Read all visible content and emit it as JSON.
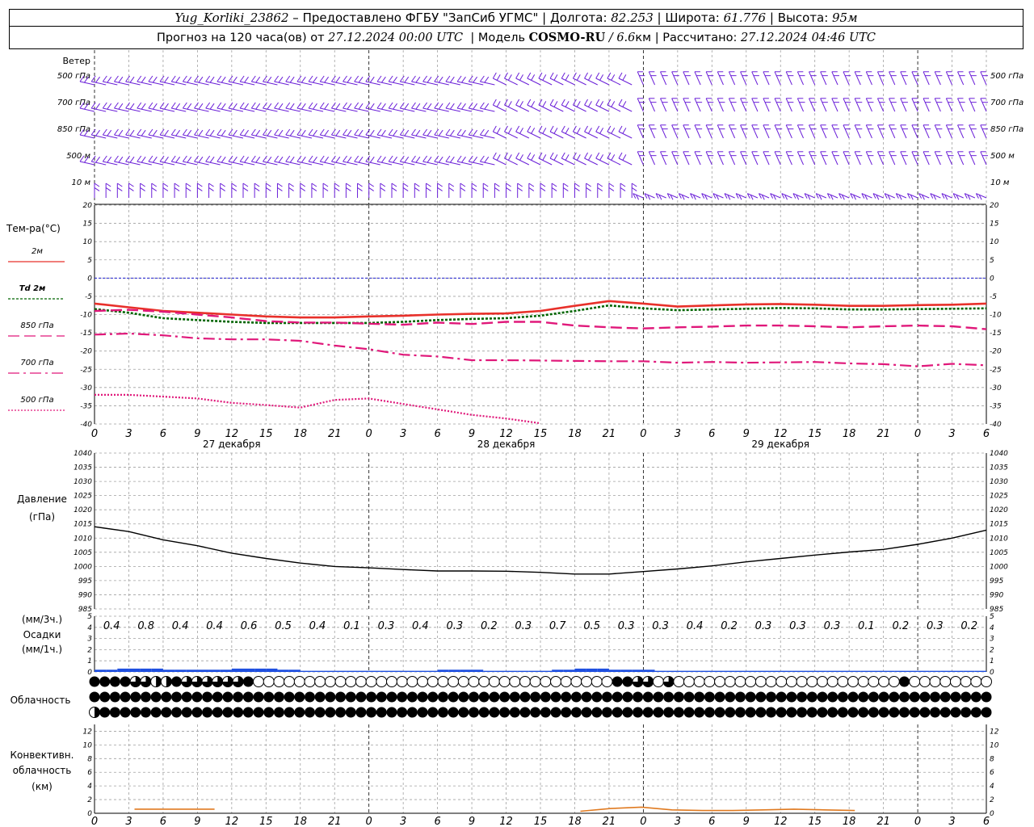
{
  "header": {
    "station": "Yug_Korliki_23862",
    "sep1": " – ",
    "provider": "Предоставлено ФГБУ \"ЗапСиб УГМС\"",
    "lon_label": "Долгота: ",
    "lon": "82.253",
    "lat_label": "Широта: ",
    "lat": "61.776",
    "alt_label": "Высота: ",
    "alt": "95м",
    "forecast_label": "Прогноз на 120 часа(ов) от ",
    "forecast_start": "27.12.2024 00:00 UTC",
    "model_label": "Модель ",
    "model": "COSMO-RU",
    "model_res": " / 6.6",
    "model_res_unit": "км",
    "calc_label": "Рассчитано: ",
    "calc_time": "27.12.2024 04:46 UTC"
  },
  "labels": {
    "wind_title": "Ветер",
    "wind_levels": [
      "500 гПа",
      "700 гПа",
      "850 гПа",
      "500 м",
      "10 м"
    ],
    "temp_title": "Тем-ра(°C)",
    "temp_legend": [
      "2м",
      "Td 2м",
      "850 гПа",
      "700 гПа",
      "500 гПа"
    ],
    "pressure_title": "Давление",
    "pressure_unit": "(гПа)",
    "precip_top": "(мм/3ч.)",
    "precip_title": "Осадки",
    "precip_unit": "(мм/1ч.)",
    "cloud_title": "Облачность",
    "conv_title_1": "Конвективн.",
    "conv_title_2": "облачность",
    "conv_unit": "(км)",
    "days": [
      "27 декабря",
      "28 декабря",
      "29 декабря"
    ]
  },
  "colors": {
    "t2m": "#e8302a",
    "td2m": "#006400",
    "upper": "#e0187a",
    "zero": "#2020d0",
    "wind": "#6a1fd8",
    "pressure": "#000000",
    "precip": "#1e4fe0",
    "conv": "#e07a20"
  },
  "chart_data": [
    {
      "type": "line",
      "name": "temperature",
      "x_hours": [
        0,
        3,
        6,
        9,
        12,
        15,
        18,
        21,
        24,
        27,
        30,
        33,
        36,
        39,
        42,
        45,
        48,
        51,
        54,
        57,
        60,
        63,
        66,
        69,
        72,
        75,
        78
      ],
      "x_tick_labels": [
        "0",
        "3",
        "6",
        "9",
        "12",
        "15",
        "18",
        "21",
        "0",
        "3",
        "6",
        "9",
        "12",
        "15",
        "18",
        "21",
        "0",
        "3",
        "6",
        "9",
        "12",
        "15",
        "18",
        "21",
        "0",
        "3",
        "6"
      ],
      "ylim": [
        -40,
        20
      ],
      "yticks": [
        20,
        15,
        10,
        5,
        0,
        -5,
        -10,
        -15,
        -20,
        -25,
        -30,
        -35,
        -40
      ],
      "series": [
        {
          "name": "2м",
          "style": "solid",
          "values": [
            -7,
            -8,
            -9,
            -9.5,
            -10,
            -10.5,
            -10.8,
            -10.8,
            -10.5,
            -10.3,
            -10,
            -9.8,
            -9.7,
            -9,
            -7.6,
            -6.3,
            -7,
            -7.8,
            -7.5,
            -7.2,
            -7.1,
            -7.3,
            -7.6,
            -7.6,
            -7.4,
            -7.3,
            -7
          ]
        },
        {
          "name": "Td 2м",
          "style": "dotted",
          "values": [
            -8.5,
            -9.5,
            -11,
            -11.5,
            -12,
            -12.3,
            -12.3,
            -12.3,
            -12.3,
            -12,
            -11.5,
            -11.2,
            -11,
            -10.3,
            -9,
            -7.5,
            -8.3,
            -8.8,
            -8.6,
            -8.4,
            -8.2,
            -8.3,
            -8.6,
            -8.6,
            -8.5,
            -8.4,
            -8.3
          ]
        },
        {
          "name": "850 гПа",
          "style": "dash",
          "values": [
            -9,
            -8.7,
            -9.2,
            -10,
            -10.8,
            -11.8,
            -12.2,
            -12.2,
            -12.5,
            -12.8,
            -12.2,
            -12.6,
            -12,
            -12,
            -13,
            -13.5,
            -13.8,
            -13.5,
            -13.3,
            -13,
            -13,
            -13.2,
            -13.5,
            -13.2,
            -13,
            -13.2,
            -14
          ]
        },
        {
          "name": "700 гПа",
          "style": "dashdot",
          "values": [
            -15.5,
            -15.2,
            -15.7,
            -16.5,
            -16.8,
            -16.8,
            -17.2,
            -18.5,
            -19.5,
            -21,
            -21.5,
            -22.5,
            -22.5,
            -22.6,
            -22.7,
            -22.8,
            -22.8,
            -23.2,
            -23,
            -23.2,
            -23.1,
            -23,
            -23.4,
            -23.6,
            -24.2,
            -23.5,
            -23.9
          ]
        },
        {
          "name": "500 гПа",
          "style": "densedot",
          "values": [
            -32,
            -32,
            -32.5,
            -33,
            -34.2,
            -34.8,
            -35.5,
            -33.4,
            -33,
            -34.5,
            -36,
            -37.5,
            -38.5,
            -39.8,
            null,
            null,
            null,
            null,
            null,
            null,
            null,
            null,
            null,
            null,
            null,
            null,
            null
          ]
        }
      ]
    },
    {
      "type": "line",
      "name": "pressure",
      "x_hours": [
        0,
        3,
        6,
        9,
        12,
        15,
        18,
        21,
        24,
        27,
        30,
        33,
        36,
        39,
        42,
        45,
        48,
        51,
        54,
        57,
        60,
        63,
        66,
        69,
        72,
        75,
        78
      ],
      "ylim": [
        985,
        1040
      ],
      "yticks": [
        1040,
        1035,
        1030,
        1025,
        1020,
        1015,
        1010,
        1005,
        1000,
        995,
        990,
        985
      ],
      "series": [
        {
          "name": "Давление",
          "values": [
            1014,
            1012.3,
            1009.4,
            1007.3,
            1004.7,
            1002.8,
            1001.2,
            1000,
            999.5,
            998.9,
            998.4,
            998.4,
            998.3,
            997.9,
            997.3,
            997.3,
            998.2,
            999.1,
            1000.2,
            1001.6,
            1002.8,
            1004,
            1005.1,
            1006,
            1007.8,
            1010,
            1012.8
          ]
        }
      ]
    },
    {
      "type": "bar",
      "name": "precipitation",
      "precip_3h_labels": [
        "0.4",
        "0.8",
        "0.4",
        "0.4",
        "0.6",
        "0.5",
        "0.4",
        "0.1",
        "0.3",
        "0.4",
        "0.3",
        "0.2",
        "0.3",
        "0.7",
        "0.5",
        "0.3",
        "0.3",
        "0.4",
        "0.2",
        "0.3",
        "0.3",
        "0.3",
        "0.1",
        "0.2",
        "0.3",
        "0.2"
      ],
      "ylim": [
        0,
        5
      ],
      "yticks": [
        5,
        4,
        3,
        2,
        1,
        0
      ],
      "hourly_values": [
        0.2,
        0.2,
        0.3,
        0.3,
        0.3,
        0.3,
        0.2,
        0.2,
        0.2,
        0.2,
        0.2,
        0.2,
        0.3,
        0.3,
        0.3,
        0.3,
        0.2,
        0.2,
        0.1,
        0.1,
        0.1,
        0.1,
        0.1,
        0.1,
        0.1,
        0.1,
        0.1,
        0.1,
        0.1,
        0.1,
        0.2,
        0.2,
        0.2,
        0.2,
        0.1,
        0.1,
        0.1,
        0.1,
        0.1,
        0.1,
        0.2,
        0.2,
        0.3,
        0.3,
        0.3,
        0.2,
        0.2,
        0.2,
        0.2,
        0.1,
        0.1,
        0.1,
        0.1,
        0.1,
        0.1,
        0.1,
        0.1,
        0.1,
        0.1,
        0.1,
        0.1,
        0.1,
        0.1,
        0.1,
        0.1,
        0.1,
        0.1,
        0.1,
        0.1,
        0.1,
        0.1,
        0.1,
        0.1,
        0.1,
        0.1,
        0.1,
        0.1,
        0.1
      ]
    },
    {
      "type": "other",
      "name": "cloudiness",
      "rows": [
        "1111223312222221000000000000000000000000000000000001122020000000000000000000000100000000",
        "1111111111111111111111111111111111111111111111111111111111111111111111111111111111111111",
        "3111111111111111111111111111111111111111111111111111111111111111111111111111111111111111"
      ]
    },
    {
      "type": "area",
      "name": "convective_cloud",
      "ylim": [
        0,
        13
      ],
      "yticks": [
        12,
        10,
        8,
        6,
        4,
        2,
        0
      ],
      "segments": [
        {
          "from_hour": 3.5,
          "to_hour": 10.5,
          "values": [
            0.6,
            0.6
          ]
        },
        {
          "from_hour": 42.5,
          "to_hour": 66.5,
          "values": [
            0.3,
            0.7,
            0.9,
            0.5,
            0.4,
            0.4,
            0.5,
            0.6,
            0.5,
            0.4
          ]
        }
      ]
    }
  ]
}
